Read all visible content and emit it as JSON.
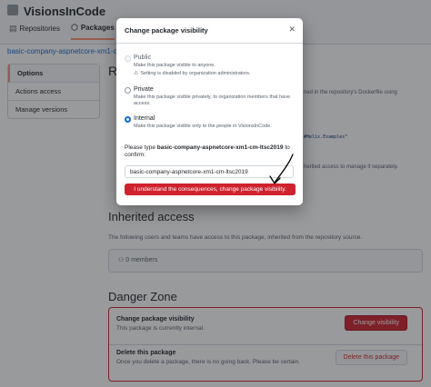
{
  "org": {
    "name": "VisionsInCode"
  },
  "nav": {
    "items": [
      {
        "label": "Repositories",
        "icon": "repo-icon"
      },
      {
        "label": "Packages",
        "icon": "package-icon",
        "active": true
      }
    ]
  },
  "package_link": "basic-company-aspnetcore-xm1-cm-ltsc20",
  "sidebar": {
    "items": [
      "Options",
      "Actions access",
      "Manage versions"
    ]
  },
  "background_fragments": {
    "heading": "R",
    "text_1": "ned in the repository's Dockerfile using",
    "code": "#Helix.Examples\"",
    "text_2": "herited access to manage it separately."
  },
  "inherited": {
    "title": "Inherited access",
    "description": "The following users and teams have access to this package, inherited from the repository source.",
    "members": "0 members"
  },
  "danger": {
    "title": "Danger Zone",
    "visibility_title": "Change package visibility",
    "visibility_desc": "This package is currently internal.",
    "visibility_button": "Change visibility",
    "delete_title": "Delete this package",
    "delete_desc": "Once you delete a package, there is no going back. Please be certain.",
    "delete_button": "Delete this package"
  },
  "modal": {
    "title": "Change package visibility",
    "options": [
      {
        "label": "Public",
        "description": "Make this package visible to anyone.",
        "warning": "Setting is disabled by organization administrators.",
        "state": "disabled"
      },
      {
        "label": "Private",
        "description": "Make this package visible privately, to organization members that have access.",
        "state": "unchecked"
      },
      {
        "label": "Internal",
        "description": "Make this package visible only to the people in VisionsInCode.",
        "state": "checked"
      }
    ],
    "confirm_prefix": "Please type",
    "confirm_name": "basic-company-aspnetcore-xm1-cm-ltsc2019",
    "confirm_suffix": "to confirm:",
    "input_value": "basic-company-aspnetcore-xm1-cm-ltsc2019",
    "confirm_button": "I understand the consequences, change package visibility."
  },
  "colors": {
    "danger": "#cf222e",
    "accent": "#0969da",
    "annotation": "#000000"
  }
}
